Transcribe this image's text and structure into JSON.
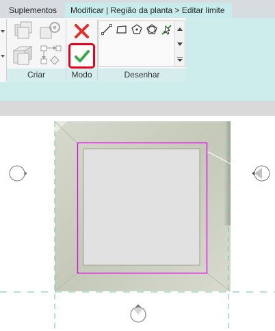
{
  "tabs": {
    "suplementos": "Suplementos",
    "modificar": "Modificar | Região da planta > Editar limite"
  },
  "panels": {
    "criar": "Criar",
    "modo": "Modo",
    "desenhar": "Desenhar"
  },
  "icons": {
    "finish": "checkmark-icon",
    "cancel": "close-icon",
    "line": "line-icon",
    "rectangle": "rectangle-icon",
    "polygon": "polygon-icon",
    "circumscribed_polygon": "circumscribed-polygon-icon",
    "pick_lines": "pick-lines-icon",
    "section_marker": "elevation-marker-icon"
  },
  "colors": {
    "ribbon": "#cdeded",
    "boundary_sketch": "#e000e0",
    "finish_highlight": "#e8001c",
    "checkmark": "#3aa64b",
    "cancel": "#e0302a"
  }
}
